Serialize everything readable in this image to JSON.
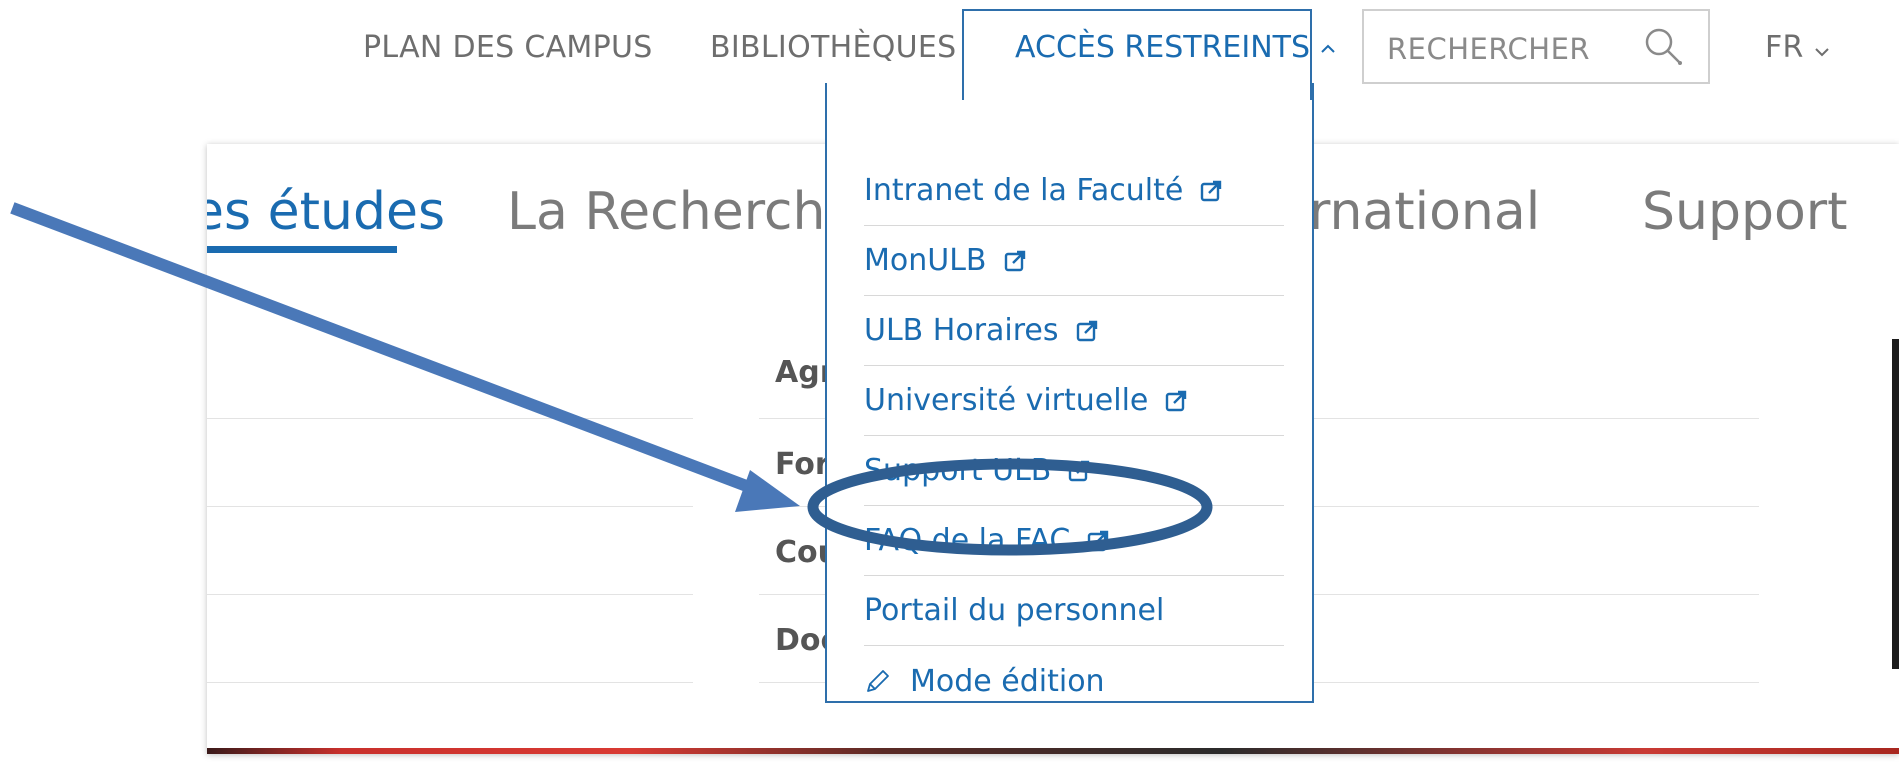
{
  "topbar": {
    "links": [
      "PLAN DES CAMPUS",
      "BIBLIOTHÈQUES"
    ],
    "acces_label": "ACCÈS RESTREINTS",
    "acces_caret": "⌃",
    "search_label": "RECHERCHER",
    "lang_label": "FR",
    "lang_caret": "⌄"
  },
  "nav": {
    "tabs": [
      "es études",
      "La Recherche",
      "ernational",
      "Support"
    ]
  },
  "submenu": {
    "items": [
      "Agr",
      "For",
      "Cou",
      "Doc"
    ]
  },
  "dropdown": {
    "items": [
      {
        "label": "Intranet de la Faculté",
        "external": true
      },
      {
        "label": "MonULB",
        "external": true
      },
      {
        "label": "ULB Horaires",
        "external": true
      },
      {
        "label": "Université virtuelle",
        "external": true
      },
      {
        "label": "Support ULB",
        "external": true
      },
      {
        "label": "FAQ de la FAC",
        "external": true
      },
      {
        "label": "Portail du personnel",
        "external": false
      }
    ],
    "edit_label": "Mode édition"
  },
  "colors": {
    "accent": "#1a6bb0",
    "annotation_arrow": "#4a78b8",
    "annotation_ellipse": "#2f5e91"
  },
  "icons": {
    "search": "search-icon",
    "external": "external-link-icon",
    "edit": "pencil-icon"
  }
}
